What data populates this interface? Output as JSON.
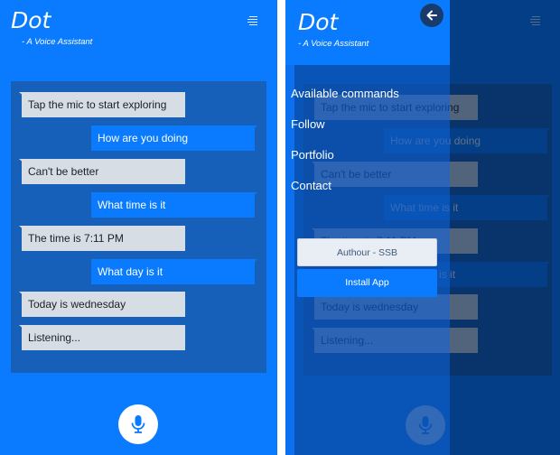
{
  "app": {
    "title": "Dot",
    "subtitle": "- A Voice Assistant"
  },
  "chat": {
    "messages": [
      {
        "role": "bot",
        "text": "Tap the mic to start exploring"
      },
      {
        "role": "user",
        "text": "How are you doing"
      },
      {
        "role": "bot",
        "text": "Can't be better"
      },
      {
        "role": "user",
        "text": "What time is it"
      },
      {
        "role": "bot",
        "text": "The time is 7:11 PM"
      },
      {
        "role": "user",
        "text": "What day is it"
      },
      {
        "role": "bot",
        "text": "Today is wednesday"
      },
      {
        "role": "bot",
        "text": "Listening..."
      }
    ]
  },
  "icons": {
    "menu": "menu-icon",
    "mic": "microphone-icon",
    "back": "arrow-left-icon"
  },
  "drawer": {
    "nav_items": [
      "Available commands",
      "Follow",
      "Portfolio",
      "Contact"
    ],
    "author_button": "Authour - SSB",
    "install_button": "Install App"
  },
  "colors": {
    "primary": "#0a7bff",
    "panel": "#1760b9",
    "bot_bubble": "#d7dde5",
    "user_bubble": "#0a7bff"
  }
}
